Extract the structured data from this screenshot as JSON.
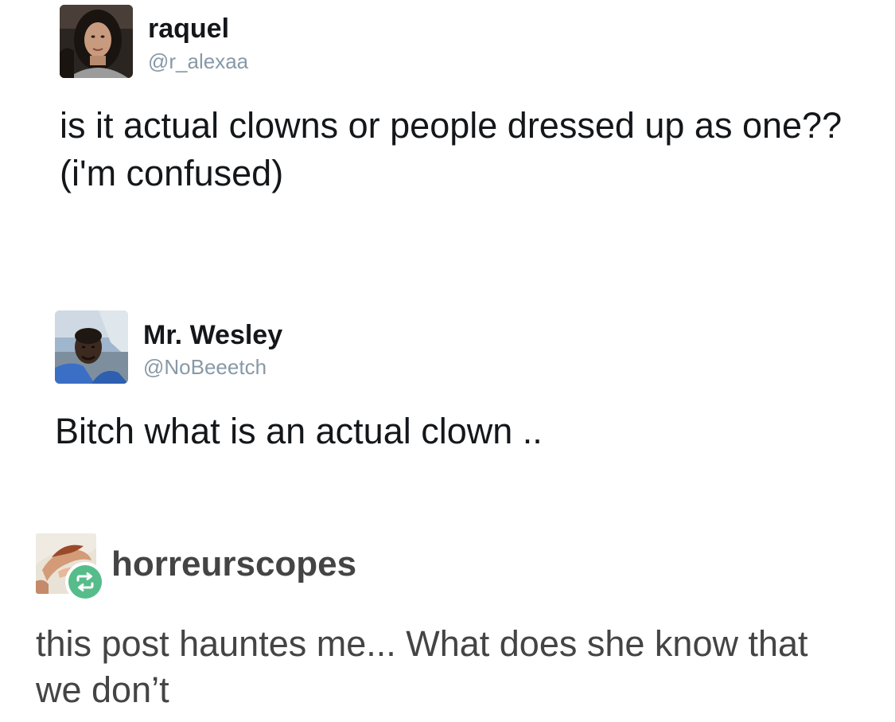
{
  "tweets": [
    {
      "display_name": "raquel",
      "handle": "@r_alexaa",
      "text": "is it actual clowns or people dressed up as one?? (i'm confused)",
      "avatar_icon": "profile-photo-woman"
    },
    {
      "display_name": "Mr. Wesley",
      "handle": "@NoBeeetch",
      "text": "Bitch what is an actual clown ..",
      "avatar_icon": "profile-photo-man"
    }
  ],
  "reblog": {
    "username": "horreurscopes",
    "text": "this post hauntes me... What does she know that we don’t",
    "avatar_icon": "profile-photo-painting",
    "badge_icon": "reblog-icon",
    "badge_color": "#56bc8a"
  }
}
